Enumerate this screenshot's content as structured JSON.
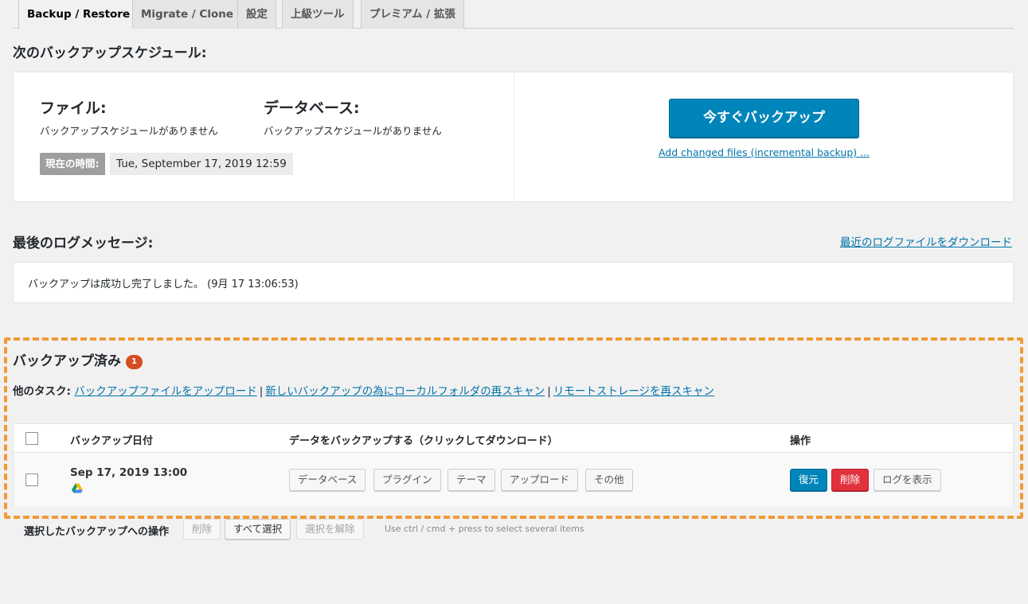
{
  "tabs": [
    {
      "label": "Backup / Restore",
      "active": true
    },
    {
      "label": "Migrate / Clone",
      "active": false
    },
    {
      "label": "設定",
      "active": false
    },
    {
      "label": "上級ツール",
      "active": false
    },
    {
      "label": "プレミアム / 拡張",
      "active": false
    }
  ],
  "schedule": {
    "heading": "次のバックアップスケジュール:",
    "files_label": "ファイル:",
    "files_value": "バックアップスケジュールがありません",
    "db_label": "データベース:",
    "db_value": "バックアップスケジュールがありません",
    "time_label": "現在の時間:",
    "time_value": "Tue, September 17, 2019 12:59",
    "backup_now_label": "今すぐバックアップ",
    "incremental_link": "Add changed files (incremental backup) ..."
  },
  "log": {
    "heading": "最後のログメッセージ:",
    "download_link": "最近のログファイルをダウンロード",
    "message": "バックアップは成功し完了しました。 (9月 17 13:06:53)"
  },
  "existing": {
    "heading": "バックアップ済み",
    "count": "1",
    "tasks_label": "他のタスク:",
    "task_upload": "バックアップファイルをアップロード",
    "task_rescan_local": "新しいバックアップの為にローカルフォルダの再スキャン",
    "task_rescan_remote": "リモートストレージを再スキャン",
    "separator": "|"
  },
  "table": {
    "col_date": "バックアップ日付",
    "col_data": "データをバックアップする（クリックしてダウンロード）",
    "col_actions": "操作",
    "row": {
      "date": "Sep 17, 2019 13:00",
      "storage_icon": "google-drive-icon",
      "data_buttons": [
        "データベース",
        "プラグイン",
        "テーマ",
        "アップロード",
        "その他"
      ],
      "restore_label": "復元",
      "delete_label": "削除",
      "view_log_label": "ログを表示"
    }
  },
  "bulk": {
    "label": "選択したバックアップへの操作",
    "delete_label": "削除",
    "select_all_label": "すべて選択",
    "deselect_label": "選択を解除",
    "hint": "Use ctrl / cmd + press to select several items"
  },
  "colors": {
    "primary": "#0085ba",
    "danger": "#e0313d",
    "badge": "#d54e21",
    "highlight": "#f29a35"
  }
}
